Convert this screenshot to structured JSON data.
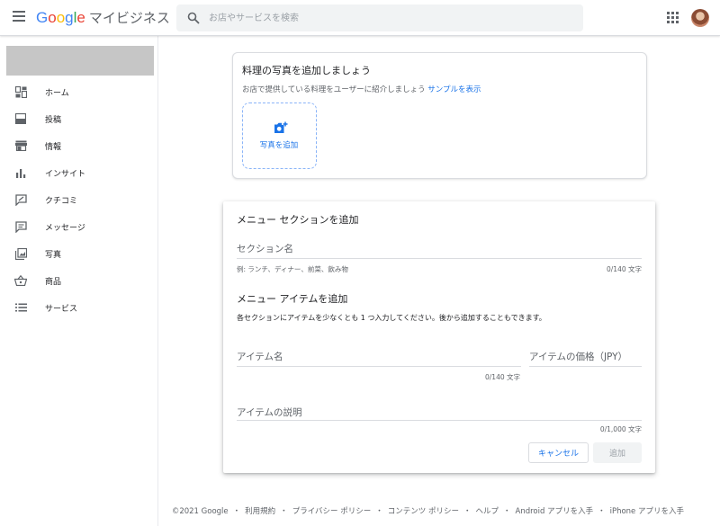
{
  "header": {
    "logo_letters": [
      "G",
      "o",
      "o",
      "g",
      "l",
      "e"
    ],
    "product_name": "マイビジネス",
    "search_placeholder": "お店やサービスを検索"
  },
  "sidebar": {
    "items": [
      {
        "label": "ホーム",
        "icon": "dashboard-icon"
      },
      {
        "label": "投稿",
        "icon": "posts-icon"
      },
      {
        "label": "情報",
        "icon": "store-icon"
      },
      {
        "label": "インサイト",
        "icon": "bar-chart-icon"
      },
      {
        "label": "クチコミ",
        "icon": "review-icon"
      },
      {
        "label": "メッセージ",
        "icon": "message-icon"
      },
      {
        "label": "写真",
        "icon": "photos-icon"
      },
      {
        "label": "商品",
        "icon": "basket-icon"
      },
      {
        "label": "サービス",
        "icon": "list-icon"
      }
    ]
  },
  "photo_card": {
    "title": "料理の写真を追加しましょう",
    "subtitle": "お店で提供している料理をユーザーに紹介しましょう",
    "sample_link": "サンプルを表示",
    "add_photo_label": "写真を追加"
  },
  "menu_card": {
    "title": "メニュー セクションを追加",
    "section_name_placeholder": "セクション名",
    "section_helper": "例: ランチ、ディナー、前菜、飲み物",
    "section_counter": "0/140 文字",
    "item_title": "メニュー アイテムを追加",
    "item_description": "各セクションにアイテムを少なくとも 1 つ入力してください。後から追加することもできます。",
    "item_name_placeholder": "アイテム名",
    "item_name_counter": "0/140 文字",
    "item_price_placeholder": "アイテムの価格（JPY）",
    "item_desc_placeholder": "アイテムの説明",
    "item_desc_counter": "0/1,000 文字",
    "cancel_label": "キャンセル",
    "add_label": "追加"
  },
  "footer": {
    "links": [
      "©2021 Google",
      "利用規約",
      "プライバシー ポリシー",
      "コンテンツ ポリシー",
      "ヘルプ",
      "Android アプリを入手",
      "iPhone アプリを入手"
    ],
    "separator": "・"
  },
  "colors": {
    "accent": "#1a73e8",
    "google_blue": "#4285f4",
    "google_red": "#ea4335",
    "google_yellow": "#fbbc05",
    "google_green": "#34a853"
  }
}
